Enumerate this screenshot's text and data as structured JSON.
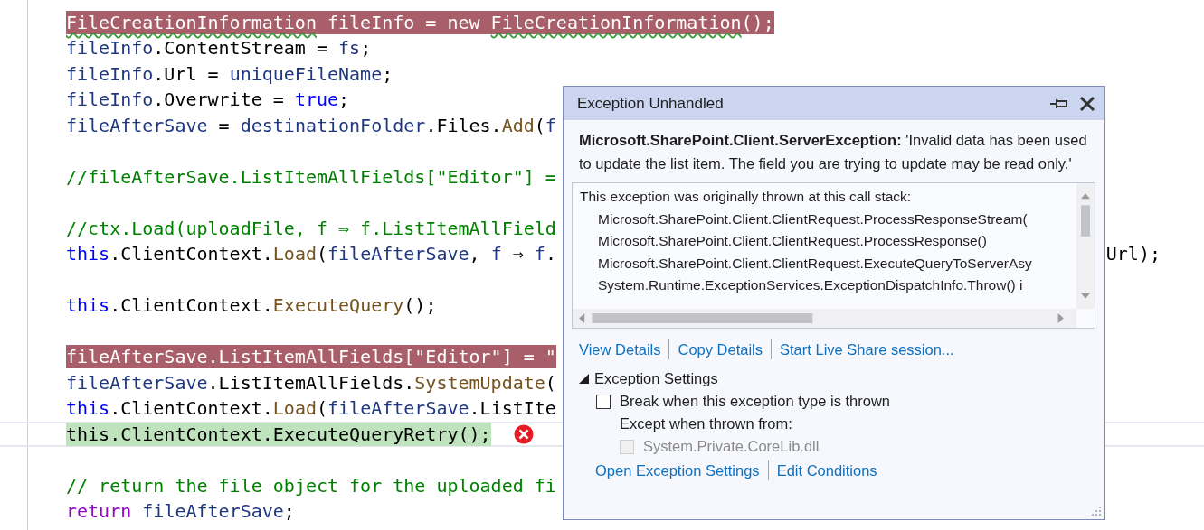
{
  "code": {
    "lines": [
      {
        "kind": "code",
        "error_highlight": true,
        "current": false,
        "error_mark": false,
        "segments": [
          {
            "t": "FileCreationInformation",
            "warn": true
          },
          {
            "t": " fileInfo = new ",
            "warn": false
          },
          {
            "t": "FileCreationInformation",
            "warn": true
          },
          {
            "t": "();",
            "warn": false
          }
        ]
      },
      {
        "kind": "code",
        "error_highlight": false,
        "current": false,
        "error_mark": false,
        "segments": [
          {
            "color": "#1f377f",
            "t": "fileInfo"
          },
          {
            "color": "#000000",
            "t": ".ContentStream = "
          },
          {
            "color": "#1f377f",
            "t": "fs"
          },
          {
            "color": "#000000",
            "t": ";"
          }
        ]
      },
      {
        "kind": "code",
        "error_highlight": false,
        "current": false,
        "error_mark": false,
        "segments": [
          {
            "color": "#1f377f",
            "t": "fileInfo"
          },
          {
            "color": "#000000",
            "t": ".Url = "
          },
          {
            "color": "#1f377f",
            "t": "uniqueFileName"
          },
          {
            "color": "#000000",
            "t": ";"
          }
        ]
      },
      {
        "kind": "code",
        "error_highlight": false,
        "current": false,
        "error_mark": false,
        "segments": [
          {
            "color": "#1f377f",
            "t": "fileInfo"
          },
          {
            "color": "#000000",
            "t": ".Overwrite = "
          },
          {
            "color": "#0000ff",
            "t": "true"
          },
          {
            "color": "#000000",
            "t": ";"
          }
        ]
      },
      {
        "kind": "code",
        "error_highlight": false,
        "current": false,
        "segments": [
          {
            "color": "#1f377f",
            "t": "fileAfterSave"
          },
          {
            "color": "#000000",
            "t": " = "
          },
          {
            "color": "#1f377f",
            "t": "destinationFolder"
          },
          {
            "color": "#000000",
            "t": ".Files."
          },
          {
            "color": "#74531f",
            "t": "Add"
          },
          {
            "color": "#000000",
            "t": "("
          },
          {
            "color": "#1f377f",
            "t": "f"
          }
        ]
      },
      {
        "kind": "blank"
      },
      {
        "kind": "code",
        "error_highlight": false,
        "current": false,
        "segments": [
          {
            "color": "#008000",
            "t": "//fileAfterSave.ListItemAllFields[\"Editor\"] ="
          }
        ]
      },
      {
        "kind": "blank"
      },
      {
        "kind": "code",
        "error_highlight": false,
        "current": false,
        "segments": [
          {
            "color": "#008000",
            "t": "//ctx.Load(uploadFile, f ⇒ f.ListItemAllField"
          }
        ]
      },
      {
        "kind": "code",
        "error_highlight": false,
        "current": false,
        "segments": [
          {
            "color": "#0000ff",
            "t": "this"
          },
          {
            "color": "#000000",
            "t": ".ClientContext."
          },
          {
            "color": "#74531f",
            "t": "Load"
          },
          {
            "color": "#000000",
            "t": "("
          },
          {
            "color": "#1f377f",
            "t": "fileAfterSave"
          },
          {
            "color": "#000000",
            "t": ", "
          },
          {
            "color": "#1f377f",
            "t": "f"
          },
          {
            "color": "#000000",
            "t": " ⇒ "
          },
          {
            "color": "#1f377f",
            "t": "f"
          },
          {
            "color": "#000000",
            "t": "."
          }
        ],
        "tail": "Url);"
      },
      {
        "kind": "blank"
      },
      {
        "kind": "code",
        "error_highlight": false,
        "current": false,
        "error_mark": false,
        "segments": [
          {
            "color": "#0000ff",
            "t": "this"
          },
          {
            "color": "#000000",
            "t": ".ClientContext."
          },
          {
            "color": "#74531f",
            "t": "ExecuteQuery"
          },
          {
            "color": "#000000",
            "t": "();"
          }
        ]
      },
      {
        "kind": "blank"
      },
      {
        "kind": "code",
        "error_highlight": true,
        "current": false,
        "error_mark": false,
        "segments": [
          {
            "t": "fileAfterSave.ListItemAllFields[\"Editor\"] = \""
          }
        ]
      },
      {
        "kind": "code",
        "error_highlight": false,
        "current": false,
        "segments": [
          {
            "color": "#1f377f",
            "t": "fileAfterSave"
          },
          {
            "color": "#000000",
            "t": ".ListItemAllFields."
          },
          {
            "color": "#74531f",
            "t": "SystemUpdate"
          },
          {
            "color": "#000000",
            "t": "("
          }
        ]
      },
      {
        "kind": "code",
        "error_highlight": false,
        "current": false,
        "segments": [
          {
            "color": "#0000ff",
            "t": "this"
          },
          {
            "color": "#000000",
            "t": ".ClientContext."
          },
          {
            "color": "#74531f",
            "t": "Load"
          },
          {
            "color": "#000000",
            "t": "("
          },
          {
            "color": "#1f377f",
            "t": "fileAfterSave"
          },
          {
            "color": "#000000",
            "t": ".ListIte"
          }
        ]
      },
      {
        "kind": "code",
        "error_highlight": false,
        "current": true,
        "error_mark": true,
        "segments": [
          {
            "color": "#000000",
            "t": "this.ClientContext.ExecuteQueryRetry();"
          }
        ]
      },
      {
        "kind": "blank"
      },
      {
        "kind": "code",
        "error_highlight": false,
        "current": false,
        "segments": [
          {
            "color": "#008000",
            "t": "// return the file object for the uploaded fi"
          }
        ]
      },
      {
        "kind": "code",
        "error_highlight": false,
        "current": false,
        "error_mark": false,
        "segments": [
          {
            "color": "#8f08c4",
            "t": "return "
          },
          {
            "color": "#1f377f",
            "t": "fileAfterSave"
          },
          {
            "color": "#000000",
            "t": ";"
          }
        ]
      }
    ]
  },
  "exception": {
    "title": "Exception Unhandled",
    "message": "**Microsoft.SharePoint.Client.ServerException:** 'Invalid data has been used to update the list item. The field you are trying to update may be read only.'",
    "stack": {
      "heading": "This exception was originally thrown at this call stack:",
      "frames": [
        "Microsoft.SharePoint.Client.ClientRequest.ProcessResponseStream(",
        "Microsoft.SharePoint.Client.ClientRequest.ProcessResponse()",
        "Microsoft.SharePoint.Client.ClientRequest.ExecuteQueryToServerAsy",
        "System.Runtime.ExceptionServices.ExceptionDispatchInfo.Throw() i"
      ]
    },
    "links": [
      "View Details",
      "Copy Details",
      "Start Live Share session..."
    ],
    "settings": {
      "label": "Exception Settings",
      "expanded": true,
      "break_option": {
        "label": "Break when this exception type is thrown",
        "checked": false,
        "disabled": false
      },
      "except_label": "Except when thrown from:",
      "module_option": {
        "label": "System.Private.CoreLib.dll",
        "checked": false,
        "disabled": true
      },
      "links": [
        "Open Exception Settings",
        "Edit Conditions"
      ]
    }
  }
}
